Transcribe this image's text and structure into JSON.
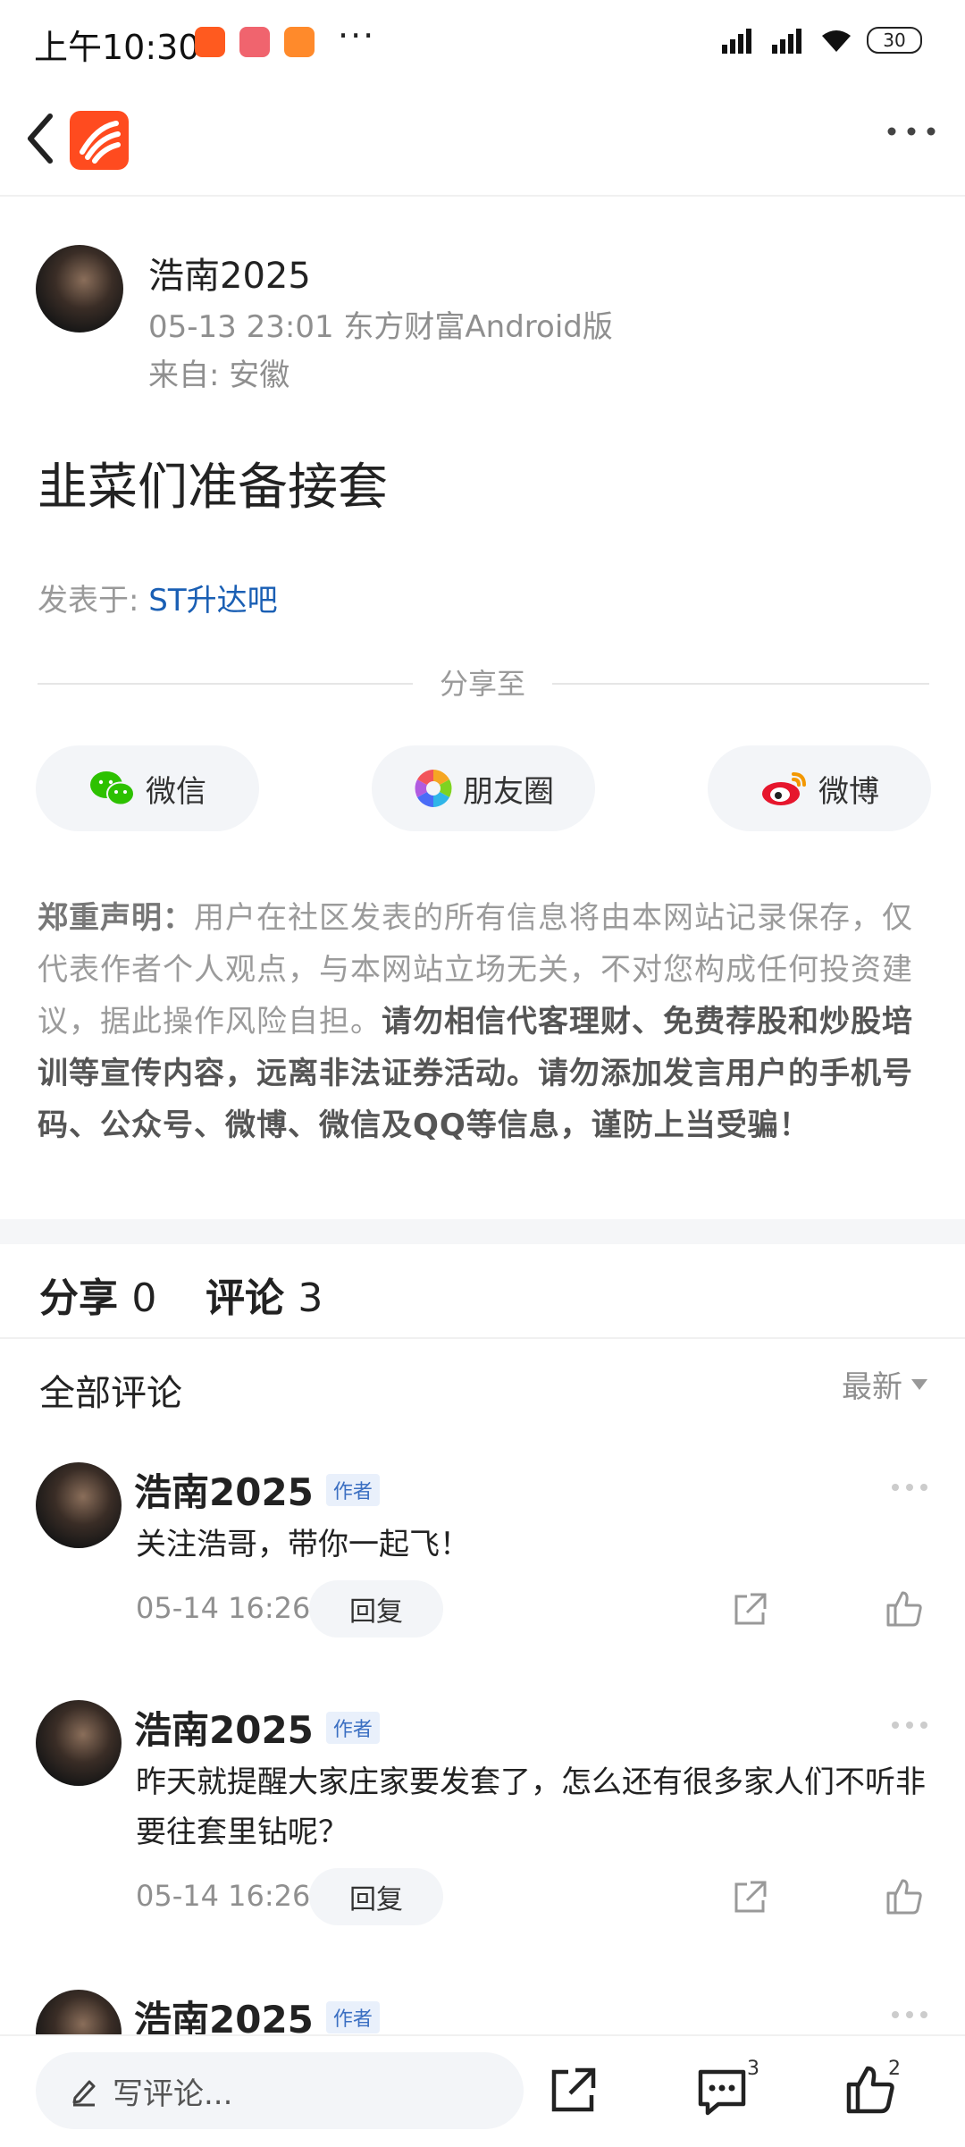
{
  "status_bar": {
    "time": "上午10:30",
    "more": "···",
    "battery": "30"
  },
  "post": {
    "author": "浩南2025",
    "timestamp": "05-13 23:01",
    "client": "东方财富Android版",
    "location": "来自: 安徽",
    "title": "韭菜们准备接套",
    "posted_in_label": "发表于: ",
    "forum": "ST升达吧"
  },
  "share": {
    "label": "分享至",
    "buttons": [
      {
        "label": "微信",
        "icon": "wechat-icon"
      },
      {
        "label": "朋友圈",
        "icon": "moments-icon"
      },
      {
        "label": "微博",
        "icon": "weibo-icon"
      }
    ]
  },
  "disclaimer": {
    "lead": "郑重声明：",
    "body": "用户在社区发表的所有信息将由本网站记录保存，仅代表作者个人观点，与本网站立场无关，不对您构成任何投资建议，据此操作风险自担。",
    "warning": "请勿相信代客理财、免费荐股和炒股培训等宣传内容，远离非法证券活动。请勿添加发言用户的手机号码、公众号、微博、微信及QQ等信息，谨防上当受骗！"
  },
  "counts": {
    "share_label": "分享",
    "share_count": "0",
    "comment_label": "评论",
    "comment_count": "3"
  },
  "comments_header": {
    "title": "全部评论",
    "sort": "最新"
  },
  "comments": [
    {
      "author": "浩南2025",
      "badge": "作者",
      "text": "关注浩哥，带你一起飞！",
      "time": "05-14 16:26",
      "reply": "回复"
    },
    {
      "author": "浩南2025",
      "badge": "作者",
      "text": "昨天就提醒大家庄家要发套了，怎么还有很多家人们不听非要往套里钻呢？",
      "time": "05-14 16:26",
      "reply": "回复"
    },
    {
      "author": "浩南2025",
      "badge": "作者"
    }
  ],
  "bottom_bar": {
    "write_placeholder": "写评论...",
    "comment_count": "3",
    "like_count": "2"
  }
}
